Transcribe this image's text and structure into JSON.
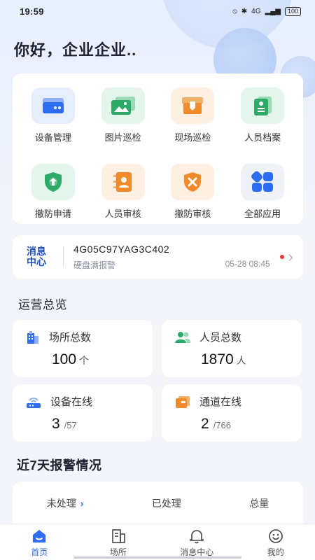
{
  "status_bar": {
    "time": "19:59",
    "network": "4G",
    "battery": "100"
  },
  "greeting": "你好，企业企业..",
  "apps": [
    {
      "label": "设备管理",
      "icon": "device-icon"
    },
    {
      "label": "图片巡检",
      "icon": "image-icon"
    },
    {
      "label": "现场巡检",
      "icon": "box-icon"
    },
    {
      "label": "人员档案",
      "icon": "document-icon"
    },
    {
      "label": "撤防申请",
      "icon": "shield-up-icon"
    },
    {
      "label": "人员审核",
      "icon": "contacts-icon"
    },
    {
      "label": "撤防审核",
      "icon": "shield-x-icon"
    },
    {
      "label": "全部应用",
      "icon": "grid-icon"
    }
  ],
  "message": {
    "logo_line1": "消息",
    "logo_line2": "中心",
    "title": "4G05C97YAG3C402",
    "subtitle": "硬盘满报警",
    "time": "05-28 08:45"
  },
  "overview": {
    "title": "运营总览",
    "stats": [
      {
        "label": "场所总数",
        "value": "100",
        "unit": "个",
        "icon": "building-icon"
      },
      {
        "label": "人员总数",
        "value": "1870",
        "unit": "人",
        "icon": "people-icon"
      },
      {
        "label": "设备在线",
        "value": "3",
        "unit": "/57",
        "icon": "router-icon"
      },
      {
        "label": "通道在线",
        "value": "2",
        "unit": "/766",
        "icon": "channel-icon"
      }
    ]
  },
  "alarm": {
    "title": "近7天报警情况",
    "tabs": [
      "未处理",
      "已处理",
      "总量"
    ]
  },
  "tabbar": [
    "首页",
    "场所",
    "消息中心",
    "我的"
  ],
  "colors": {
    "accent": "#2b6cf0",
    "alarm_dot": "#e53935"
  }
}
